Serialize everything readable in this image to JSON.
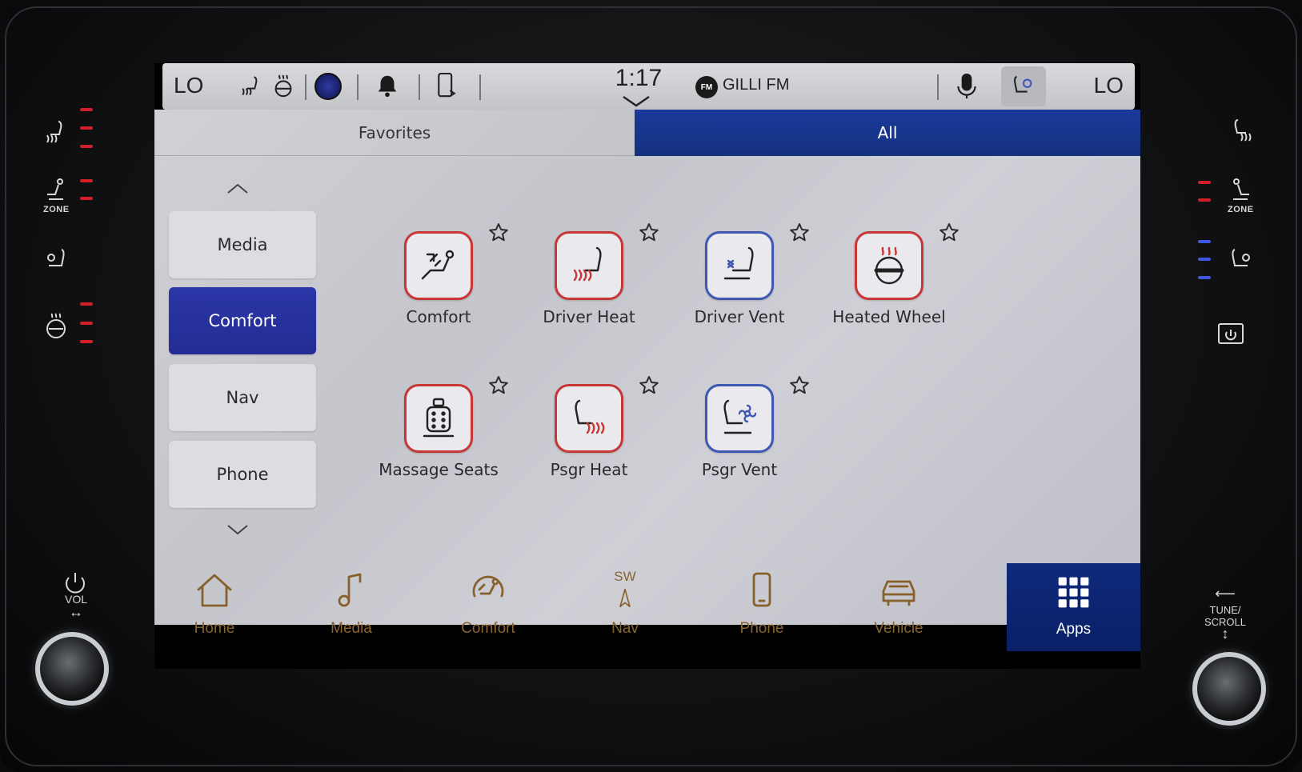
{
  "status_bar": {
    "left_temp": "LO",
    "right_temp": "LO",
    "time": "1:17",
    "radio_badge": "FM",
    "radio_station": "GILLI FM"
  },
  "tabs": {
    "favorites": "Favorites",
    "all": "All"
  },
  "categories": [
    {
      "label": "Media",
      "active": false
    },
    {
      "label": "Comfort",
      "active": true
    },
    {
      "label": "Nav",
      "active": false
    },
    {
      "label": "Phone",
      "active": false
    }
  ],
  "apps": [
    {
      "label": "Comfort",
      "icon": "comfort-icon",
      "border": "#c83636"
    },
    {
      "label": "Driver Heat",
      "icon": "driver-heat-icon",
      "border": "#c83636"
    },
    {
      "label": "Driver Vent",
      "icon": "driver-vent-icon",
      "border": "#3f58b3"
    },
    {
      "label": "Heated Wheel",
      "icon": "heated-wheel-icon",
      "border": "#c83636"
    },
    {
      "label": "Massage Seats",
      "icon": "massage-seat-icon",
      "border": "#c83636"
    },
    {
      "label": "Psgr Heat",
      "icon": "passenger-heat-icon",
      "border": "#c83636"
    },
    {
      "label": "Psgr Vent",
      "icon": "passenger-vent-icon",
      "border": "#3f58b3"
    }
  ],
  "nav": {
    "home": "Home",
    "media": "Media",
    "comfort": "Comfort",
    "nav": "Nav",
    "nav_heading": "SW",
    "phone": "Phone",
    "vehicle": "Vehicle",
    "apps": "Apps"
  },
  "bezel": {
    "left_zone": "ZONE",
    "right_zone": "ZONE",
    "vol": "VOL",
    "tune": "TUNE/ SCROLL"
  },
  "colors": {
    "accent_blue": "#1a3a9a",
    "heat_red": "#c83636",
    "vent_blue": "#3f58b3",
    "nav_inactive": "#86612c"
  }
}
